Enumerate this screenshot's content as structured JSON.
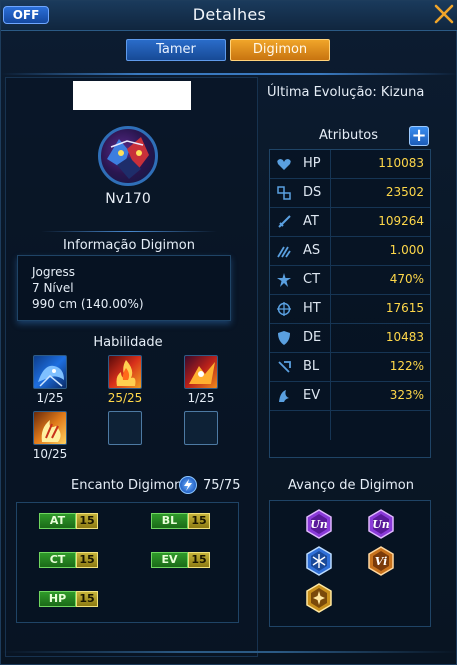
{
  "window": {
    "title": "Detalhes",
    "off_label": "OFF"
  },
  "tabs": [
    {
      "label": "Tamer"
    },
    {
      "label": "Digimon"
    }
  ],
  "digimon": {
    "level": "Nv170"
  },
  "info": {
    "title": "Informação Digimon",
    "lines": [
      "Jogress",
      "7 Nível",
      "990 cm (140.00%)"
    ]
  },
  "skills": {
    "title": "Habilidade",
    "items": [
      {
        "icon": "blue-dragon-skill-icon",
        "count": "1/25"
      },
      {
        "icon": "red-flame-skill-icon",
        "count": "25/25"
      },
      {
        "icon": "fire-beast-skill-icon",
        "count": "1/25"
      },
      {
        "icon": "fire-claw-skill-icon",
        "count": "10/25"
      }
    ]
  },
  "charm": {
    "title": "Encanto Digimon",
    "count": "75/75",
    "badges": [
      {
        "label": "AT",
        "value": "15"
      },
      {
        "label": "BL",
        "value": "15"
      },
      {
        "label": "CT",
        "value": "15"
      },
      {
        "label": "EV",
        "value": "15"
      },
      {
        "label": "HP",
        "value": "15"
      }
    ]
  },
  "last_evolution": "Última Evolução: Kizuna",
  "attributes": {
    "title": "Atributos",
    "plus_label": "+",
    "rows": [
      {
        "name": "HP",
        "value": "110083",
        "icon": "heart-icon"
      },
      {
        "name": "DS",
        "value": "23502",
        "icon": "digisoul-icon"
      },
      {
        "name": "AT",
        "value": "109264",
        "icon": "sword-icon"
      },
      {
        "name": "AS",
        "value": "1.000",
        "icon": "attack-speed-icon"
      },
      {
        "name": "CT",
        "value": "470%",
        "icon": "critical-icon"
      },
      {
        "name": "HT",
        "value": "17615",
        "icon": "crosshair-icon"
      },
      {
        "name": "DE",
        "value": "10483",
        "icon": "shield-icon"
      },
      {
        "name": "BL",
        "value": "122%",
        "icon": "block-icon"
      },
      {
        "name": "EV",
        "value": "323%",
        "icon": "evade-icon"
      }
    ]
  },
  "advancement": {
    "title": "Avanço de Digimon",
    "badges": [
      {
        "text": "Un",
        "color": "#8a3ad8"
      },
      {
        "text": "Un",
        "color": "#8a3ad8"
      },
      {
        "text": "",
        "color": "#2f6fd8"
      },
      {
        "text": "Vi",
        "color": "#c8721c"
      },
      {
        "text": "",
        "color": "#c8901c"
      }
    ]
  },
  "colors": {
    "accent_orange": "#e89420",
    "accent_blue": "#2a6cc9",
    "value_gold": "#ffd84a",
    "badge_green": "#2f9a2a"
  }
}
